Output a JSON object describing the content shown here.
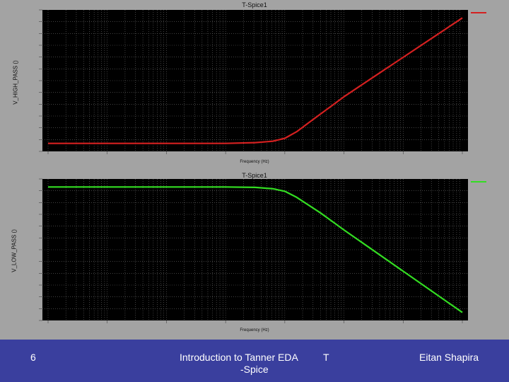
{
  "footer": {
    "page_number": "6",
    "course_line1": "Introduction to Tanner EDA",
    "course_line2": "-Spice",
    "letter": "T",
    "author": "Eitan Shapira"
  },
  "chart_data": [
    {
      "type": "line",
      "title": "T-Spice1",
      "xlabel": "Frequency (Hz)",
      "ylabel": "V_HIGH_PASS ()",
      "xscale": "log",
      "grid": true,
      "legend_placement": "top-right",
      "series": [
        {
          "color": "#d42020",
          "x": [
            0,
            0.5,
            1.0,
            1.5,
            2.0,
            2.5,
            3.0,
            3.5,
            3.8,
            4.0,
            4.2,
            4.4,
            4.6,
            4.8,
            5.0,
            5.5,
            6.0,
            6.5,
            7.0
          ],
          "y": [
            0.0,
            0.0,
            0.0,
            0.0,
            0.0,
            0.0,
            0.0,
            0.01,
            0.03,
            0.07,
            0.16,
            0.28,
            0.4,
            0.52,
            0.64,
            0.91,
            1.18,
            1.45,
            1.72
          ]
        }
      ]
    },
    {
      "type": "line",
      "title": "T-Spice1",
      "xlabel": "Frequency (Hz)",
      "ylabel": "V_LOW_PASS ()",
      "xscale": "log",
      "grid": true,
      "legend_placement": "top-right",
      "series": [
        {
          "color": "#33dd22",
          "x": [
            0,
            0.5,
            1.0,
            1.5,
            2.0,
            2.5,
            3.0,
            3.5,
            3.8,
            4.0,
            4.2,
            4.4,
            4.6,
            4.8,
            5.0,
            5.5,
            6.0,
            6.5,
            7.0
          ],
          "y": [
            1.0,
            1.0,
            1.0,
            1.0,
            1.0,
            1.0,
            1.0,
            0.995,
            0.98,
            0.95,
            0.88,
            0.79,
            0.7,
            0.6,
            0.5,
            0.26,
            0.02,
            -0.22,
            -0.46
          ]
        }
      ]
    }
  ]
}
